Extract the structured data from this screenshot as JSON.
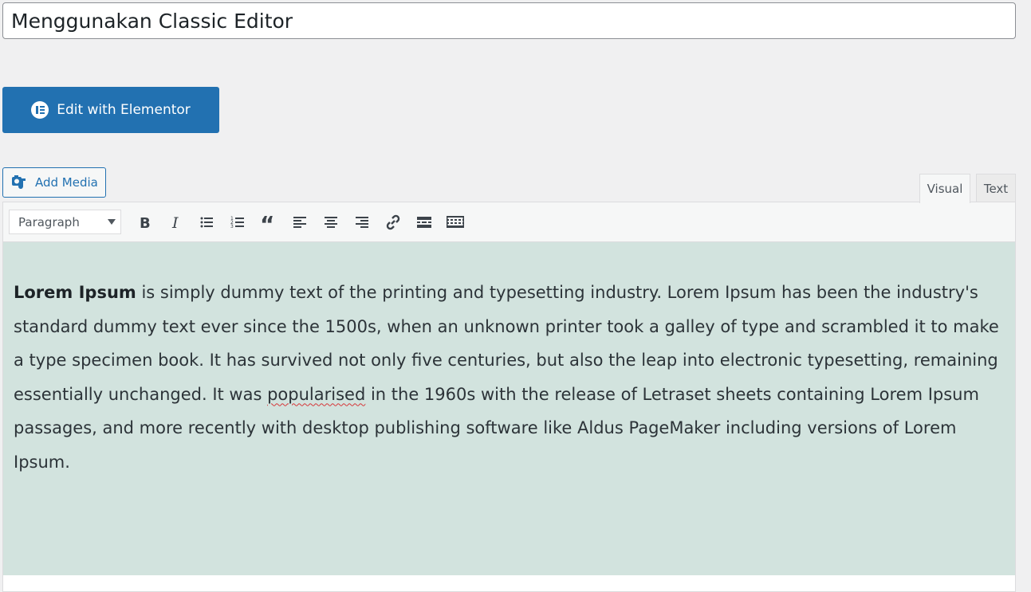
{
  "post": {
    "title": "Menggunakan Classic Editor"
  },
  "buttons": {
    "elementor_label": "Edit with Elementor",
    "add_media_label": "Add Media"
  },
  "tabs": {
    "visual": "Visual",
    "text": "Text"
  },
  "toolbar": {
    "format_selected": "Paragraph",
    "buttons": [
      "bold-icon",
      "italic-icon",
      "bullet-list-icon",
      "numbered-list-icon",
      "blockquote-icon",
      "align-left-icon",
      "align-center-icon",
      "align-right-icon",
      "link-icon",
      "read-more-icon",
      "toolbar-toggle-icon"
    ]
  },
  "content": {
    "bold_lead": "Lorem Ipsum",
    "part1": " is simply dummy text of the printing and typesetting industry. Lorem Ipsum has been the industry's standard dummy text ever since the 1500s, when an unknown printer took a galley of type and scrambled it to make a type specimen book. It has survived not only five centuries, but also the leap into electronic typesetting, remaining essentially unchanged. It was ",
    "misspelled": "popularised",
    "part2": " in the 1960s with the release of Letraset sheets containing Lorem Ipsum passages, and more recently with desktop publishing software like Aldus PageMaker including versions of Lorem Ipsum."
  },
  "colors": {
    "accent": "#2271b1",
    "content_bg": "#d2e3de",
    "page_bg": "#f0f0f1",
    "spell_error": "#d63638"
  }
}
